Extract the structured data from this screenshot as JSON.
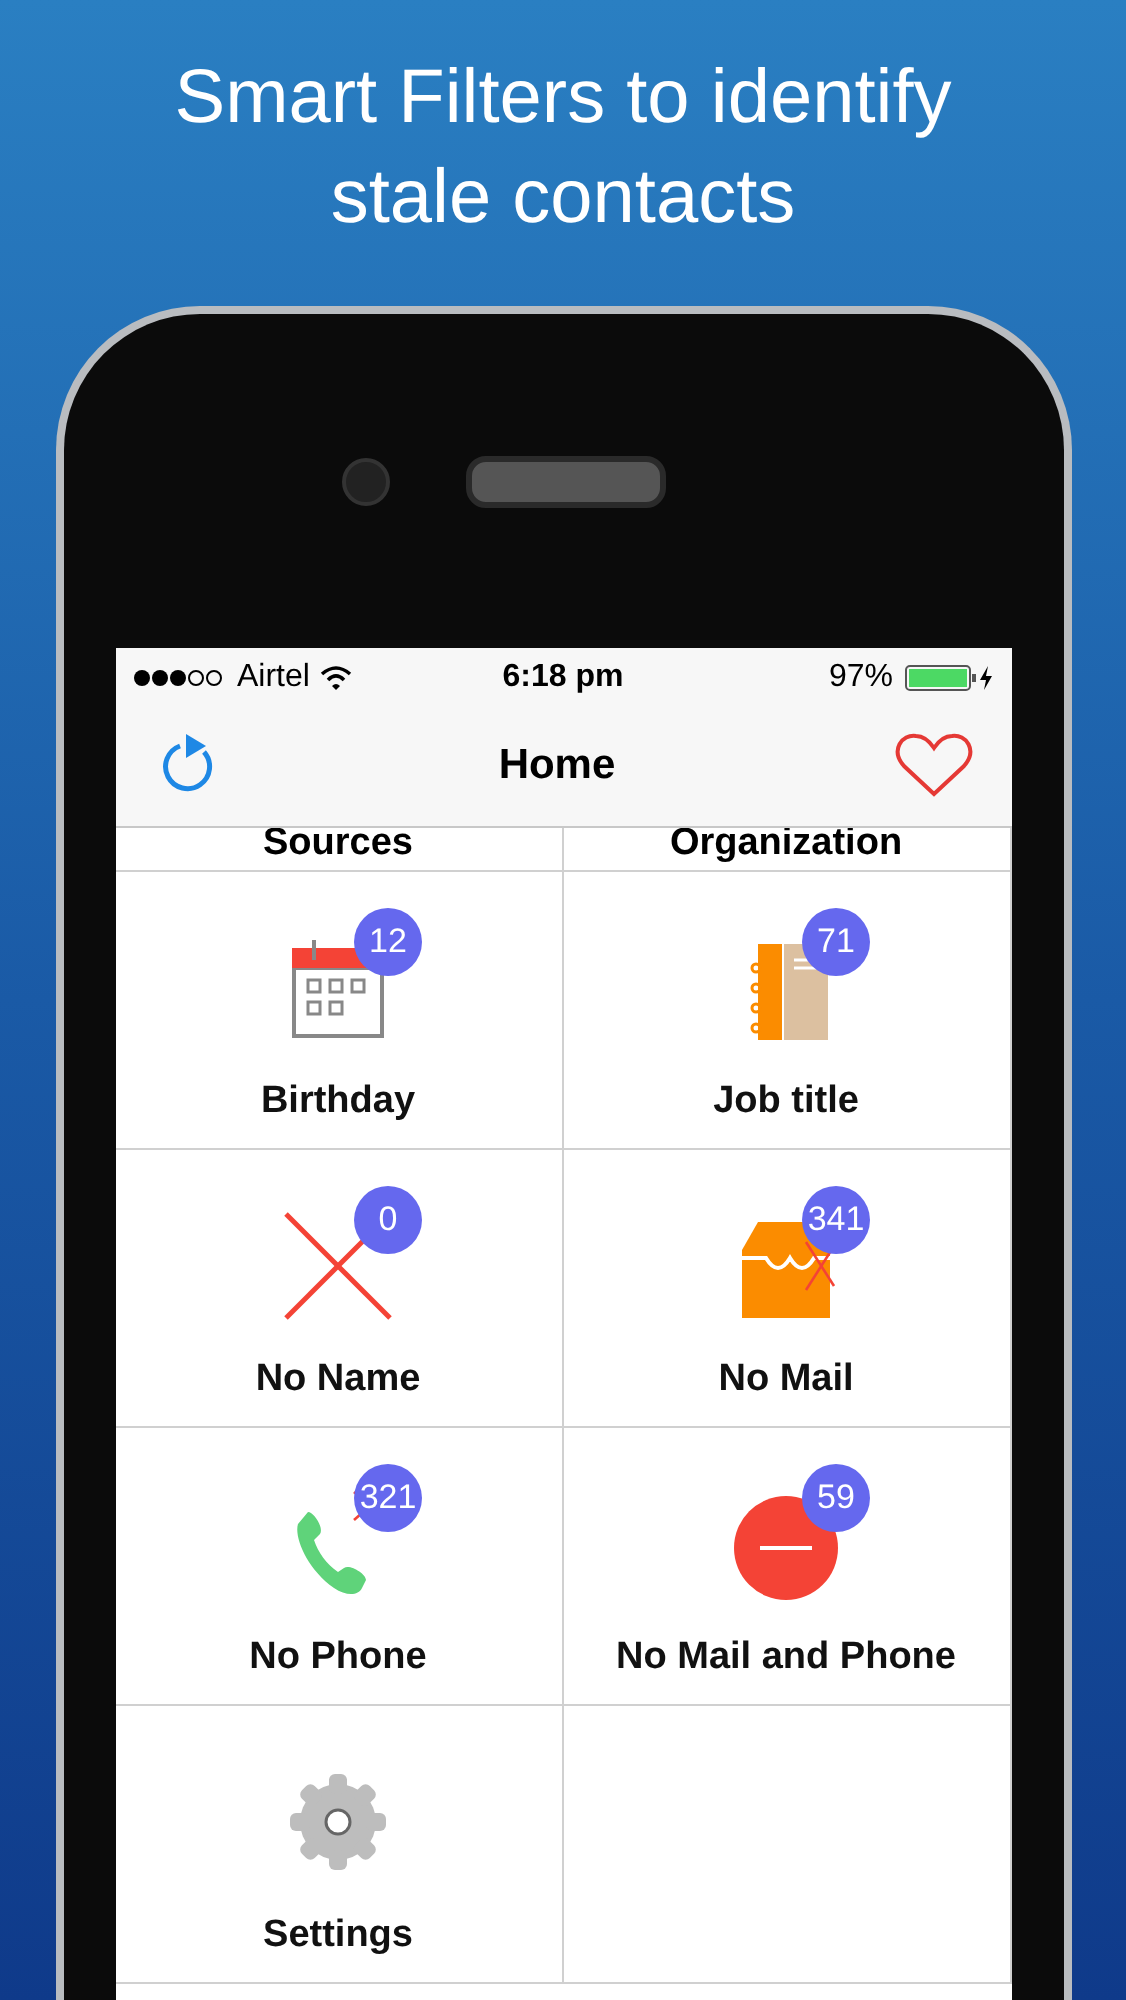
{
  "headline": "Smart Filters to identify stale contacts",
  "status_bar": {
    "carrier": "Airtel",
    "time": "6:18 pm",
    "battery": "97%"
  },
  "nav_bar": {
    "title": "Home"
  },
  "partial_row": [
    {
      "label": "Sources"
    },
    {
      "label": "Organization"
    }
  ],
  "tiles": [
    {
      "kind": "calendar",
      "label": "Birthday",
      "badge": "12"
    },
    {
      "kind": "notebook",
      "label": "Job title",
      "badge": "71"
    },
    {
      "kind": "cross",
      "label": "No Name",
      "badge": "0"
    },
    {
      "kind": "inbox",
      "label": "No Mail",
      "badge": "341"
    },
    {
      "kind": "phone",
      "label": "No Phone",
      "badge": "321"
    },
    {
      "kind": "minus",
      "label": "No Mail and Phone",
      "badge": "59"
    },
    {
      "kind": "gear",
      "label": "Settings"
    }
  ]
}
